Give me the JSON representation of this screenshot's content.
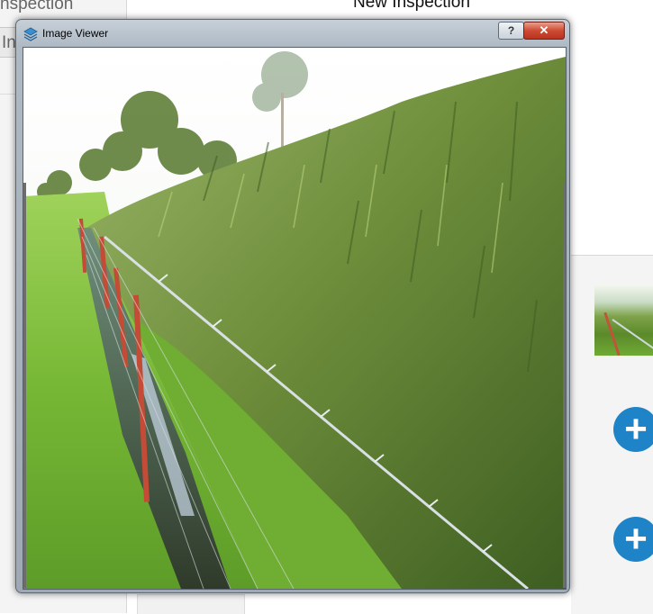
{
  "background_app": {
    "tab_label": "nspection",
    "tab_short": "In",
    "title": "New Inspection",
    "add_button_glyph": "+"
  },
  "dialog": {
    "title": "Image Viewer",
    "help_glyph": "?",
    "close_glyph": "✕",
    "icon": "layers-icon"
  },
  "image": {
    "subject": "grass field with barbed wire fence beside tall green grass bank",
    "colors": {
      "sky": "#f4f7f3",
      "grass_light": "#7fc23b",
      "grass_dark": "#3f6b1f",
      "fence_post": "#c44b35",
      "wire": "#c9d1d6"
    }
  }
}
